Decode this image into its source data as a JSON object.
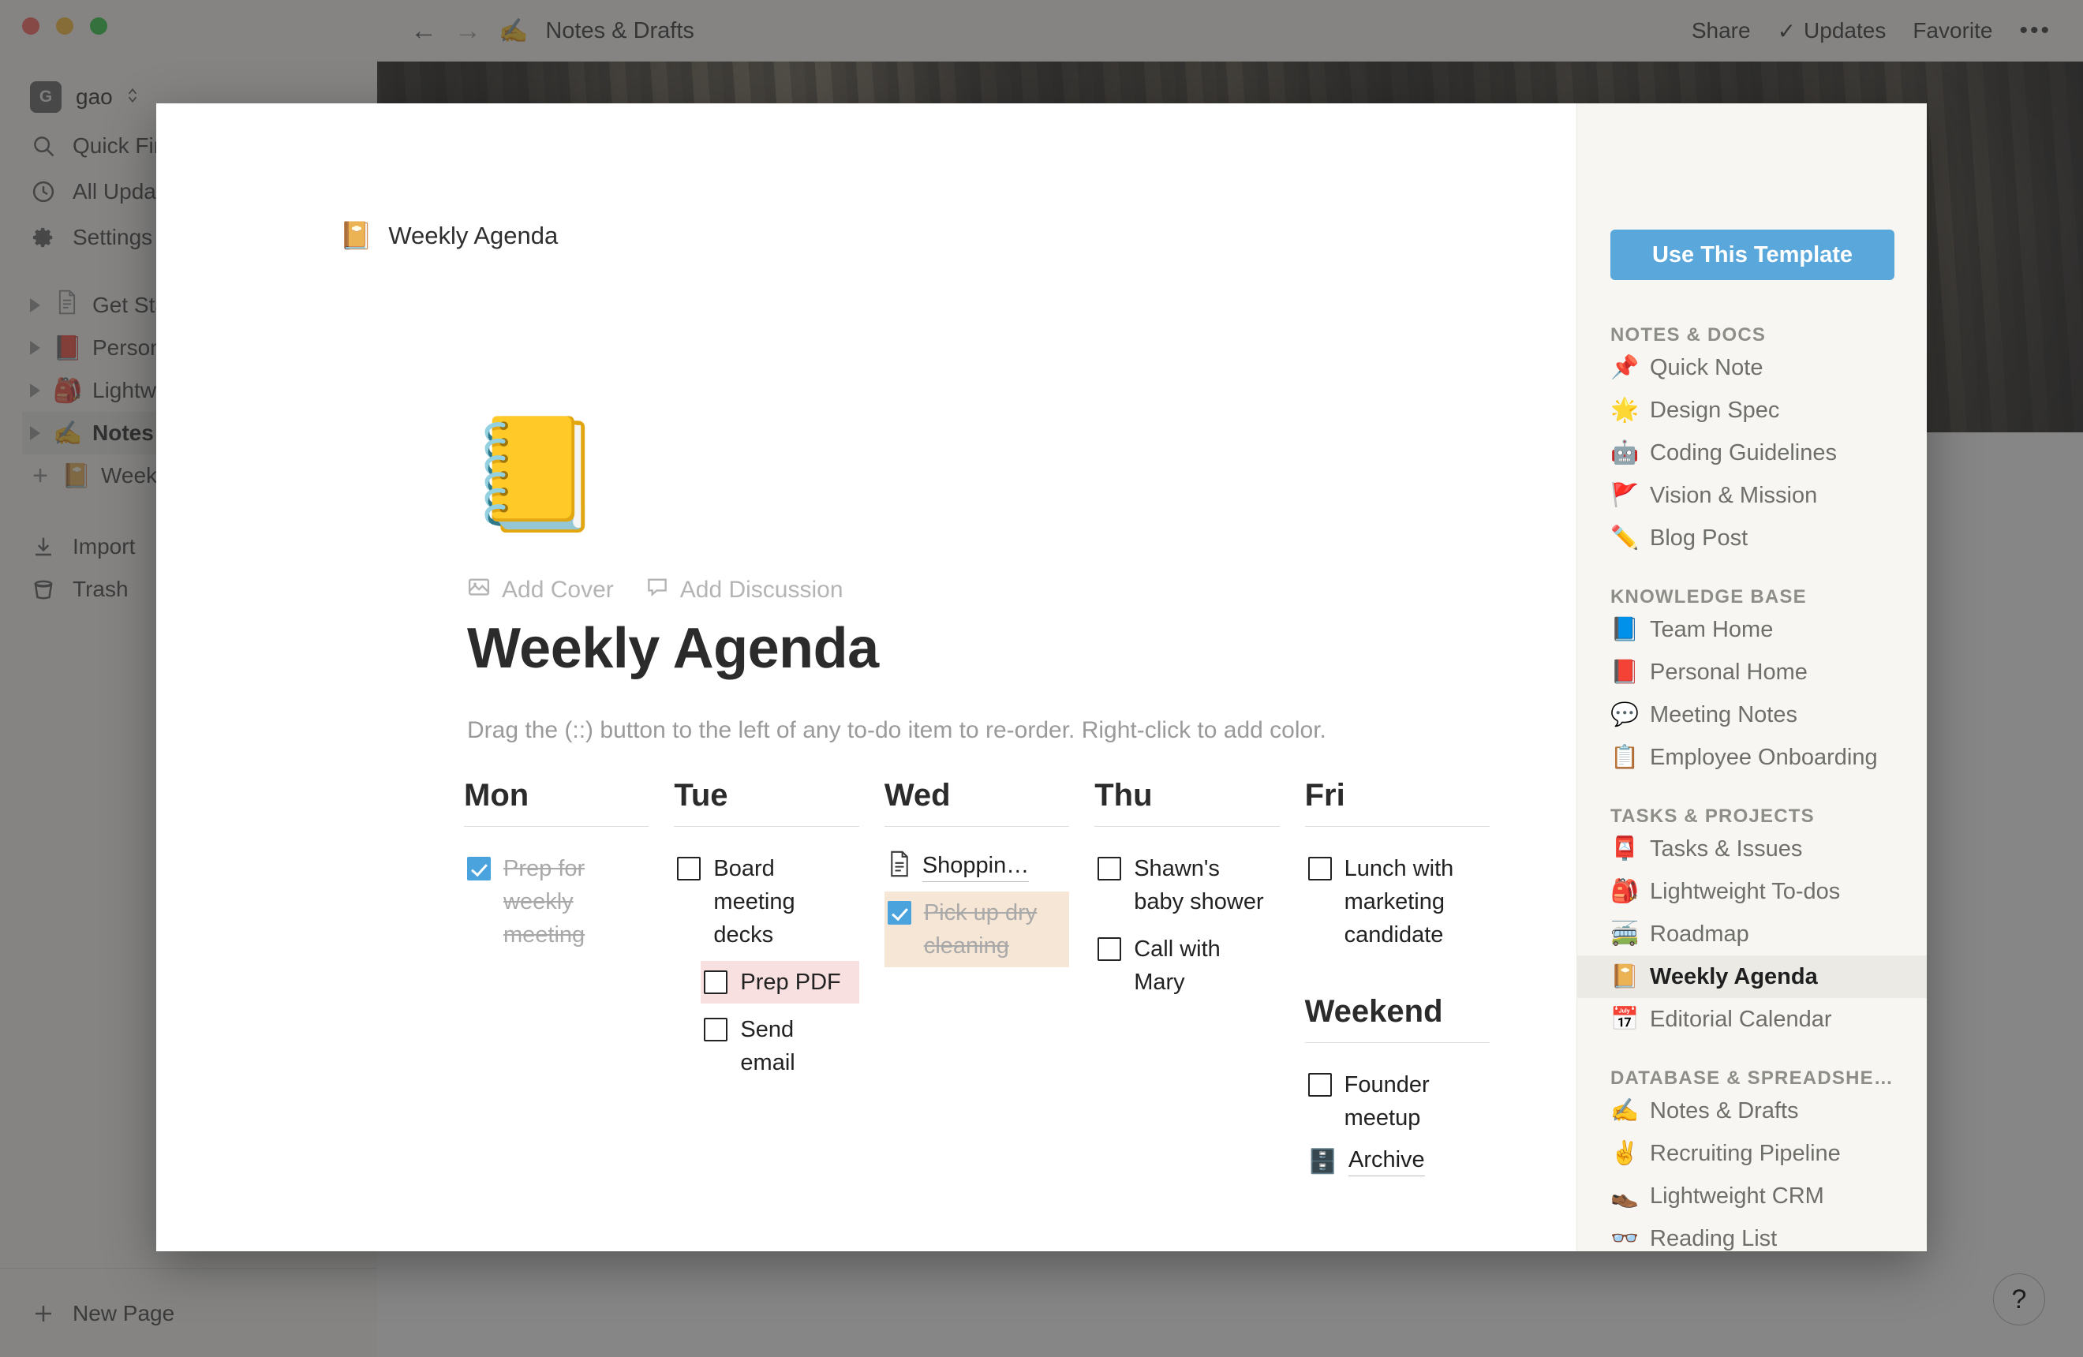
{
  "window": {
    "traffic_lights": [
      "close",
      "minimize",
      "zoom"
    ]
  },
  "sidebar": {
    "user": {
      "avatar_initial": "G",
      "name": "gao",
      "chevron": "⌃⌄"
    },
    "nav": [
      {
        "label": "Quick Find",
        "icon": "search-icon"
      },
      {
        "label": "All Updates",
        "icon": "clock-icon"
      },
      {
        "label": "Settings",
        "icon": "gear-icon"
      }
    ],
    "tree": [
      {
        "label": "Get Started",
        "emoji": "📄",
        "active": false,
        "expandable": true
      },
      {
        "label": "Personal Home",
        "emoji": "📕",
        "active": false,
        "expandable": true
      },
      {
        "label": "Lightweight To-dos",
        "emoji": "🎒",
        "active": false,
        "expandable": true
      },
      {
        "label": "Notes & Drafts",
        "emoji": "✍️",
        "active": true,
        "expandable": true
      },
      {
        "label": "Weekly Agenda",
        "emoji": "📔",
        "active": false,
        "expandable": false
      }
    ],
    "utility": [
      {
        "label": "Import",
        "icon": "import-icon"
      },
      {
        "label": "Trash",
        "icon": "trash-icon"
      }
    ],
    "new_page_label": "New Page"
  },
  "topbar": {
    "back": "←",
    "forward": "→",
    "page_emoji": "✍️",
    "page_title": "Notes & Drafts",
    "share_label": "Share",
    "updates_label": "Updates",
    "updates_check": "✓",
    "favorite_label": "Favorite",
    "more_label": "•••"
  },
  "help": {
    "label": "?"
  },
  "modal": {
    "breadcrumb": {
      "emoji": "📔",
      "label": "Weekly Agenda"
    },
    "doc": {
      "emoji": "📒",
      "add_cover_label": "Add Cover",
      "add_discussion_label": "Add Discussion",
      "title": "Weekly Agenda",
      "hint": "Drag the (::) button to the left of any to-do item to re-order. Right-click to add color."
    },
    "days": [
      {
        "name": "Mon",
        "items": [
          {
            "kind": "todo",
            "text": "Prep for weekly meeting",
            "checked": true,
            "indent": false,
            "highlight": "none"
          }
        ]
      },
      {
        "name": "Tue",
        "items": [
          {
            "kind": "todo",
            "text": "Board meeting decks",
            "checked": false,
            "indent": false,
            "highlight": "none"
          },
          {
            "kind": "todo",
            "text": "Prep PDF",
            "checked": false,
            "indent": true,
            "highlight": "pink"
          },
          {
            "kind": "todo",
            "text": "Send email",
            "checked": false,
            "indent": true,
            "highlight": "none"
          }
        ]
      },
      {
        "name": "Wed",
        "items": [
          {
            "kind": "pagelink",
            "text": "Shoppin…",
            "icon": "page-icon"
          },
          {
            "kind": "todo",
            "text": "Pick up dry cleaning",
            "checked": true,
            "indent": false,
            "highlight": "peach"
          }
        ]
      },
      {
        "name": "Thu",
        "items": [
          {
            "kind": "todo",
            "text": "Shawn's baby shower",
            "checked": false,
            "indent": false,
            "highlight": "none"
          },
          {
            "kind": "todo",
            "text": "Call with Mary",
            "checked": false,
            "indent": false,
            "highlight": "none"
          }
        ]
      },
      {
        "name": "Fri",
        "items": [
          {
            "kind": "todo",
            "text": "Lunch with marketing candidate",
            "checked": false,
            "indent": false,
            "highlight": "none"
          }
        ],
        "subsection": {
          "name": "Weekend",
          "items": [
            {
              "kind": "todo",
              "text": "Founder meetup",
              "checked": false,
              "indent": false,
              "highlight": "none"
            },
            {
              "kind": "emojilink",
              "text": "Archive",
              "emoji": "🗄️"
            }
          ]
        }
      }
    ],
    "rail": {
      "use_template_label": "Use This Template",
      "sections": [
        {
          "title": "NOTES & DOCS",
          "items": [
            {
              "label": "Quick Note",
              "emoji": "📌",
              "active": false
            },
            {
              "label": "Design Spec",
              "emoji": "🌟",
              "active": false
            },
            {
              "label": "Coding Guidelines",
              "emoji": "🤖",
              "active": false
            },
            {
              "label": "Vision & Mission",
              "emoji": "🚩",
              "active": false
            },
            {
              "label": "Blog Post",
              "emoji": "✏️",
              "active": false
            }
          ]
        },
        {
          "title": "KNOWLEDGE BASE",
          "items": [
            {
              "label": "Team Home",
              "emoji": "📘",
              "active": false
            },
            {
              "label": "Personal Home",
              "emoji": "📕",
              "active": false
            },
            {
              "label": "Meeting Notes",
              "emoji": "💬",
              "active": false
            },
            {
              "label": "Employee Onboarding",
              "emoji": "📋",
              "active": false
            }
          ]
        },
        {
          "title": "TASKS & PROJECTS",
          "items": [
            {
              "label": "Tasks & Issues",
              "emoji": "📮",
              "active": false
            },
            {
              "label": "Lightweight To-dos",
              "emoji": "🎒",
              "active": false
            },
            {
              "label": "Roadmap",
              "emoji": "🚎",
              "active": false
            },
            {
              "label": "Weekly Agenda",
              "emoji": "📔",
              "active": true
            },
            {
              "label": "Editorial Calendar",
              "emoji": "📅",
              "active": false
            }
          ]
        },
        {
          "title": "DATABASE & SPREADSHEE…",
          "items": [
            {
              "label": "Notes & Drafts",
              "emoji": "✍️",
              "active": false
            },
            {
              "label": "Recruiting Pipeline",
              "emoji": "✌️",
              "active": false
            },
            {
              "label": "Lightweight CRM",
              "emoji": "👞",
              "active": false
            },
            {
              "label": "Reading List",
              "emoji": "👓",
              "active": false
            }
          ]
        }
      ]
    }
  },
  "colors": {
    "accent_blue": "#5aa7db",
    "checkbox_blue": "#4ba3dd",
    "highlight_pink": "#f9e0e0",
    "highlight_peach": "#f6e6d6",
    "rail_bg": "#f7f6f2"
  }
}
